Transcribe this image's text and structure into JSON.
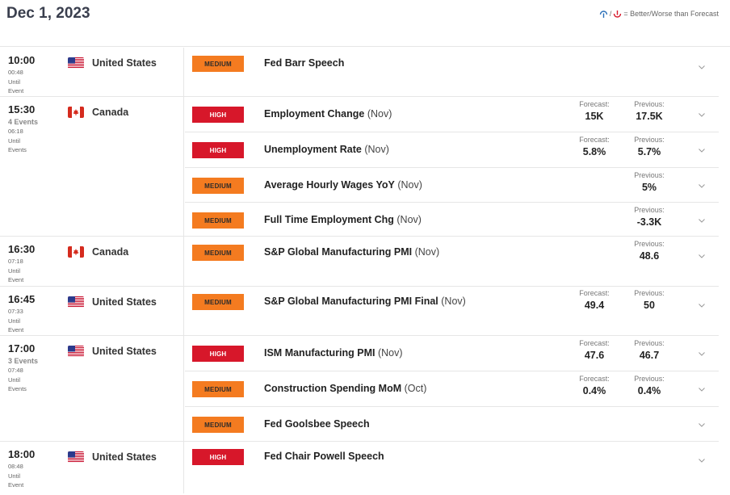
{
  "header": {
    "date": "Dec 1, 2023",
    "legend_slash": "/",
    "legend_text": "= Better/Worse than Forecast"
  },
  "colors": {
    "medium": "#f47b20",
    "high": "#d7172a"
  },
  "groups": [
    {
      "time": "10:00",
      "count": "",
      "until_time": "00:48",
      "until_label": "Until",
      "event_label": "Event",
      "country": "United States",
      "flag": "us-flag",
      "events": [
        {
          "impact": "MEDIUM",
          "level": "medium",
          "name": "Fed Barr Speech",
          "period": "",
          "forecast_label": "",
          "forecast": "",
          "previous_label": "",
          "previous": ""
        }
      ]
    },
    {
      "time": "15:30",
      "count": "4 Events",
      "until_time": "06:18",
      "until_label": "Until",
      "event_label": "Events",
      "country": "Canada",
      "flag": "ca-flag",
      "events": [
        {
          "impact": "HIGH",
          "level": "high",
          "name": "Employment Change",
          "period": "(Nov)",
          "forecast_label": "Forecast:",
          "forecast": "15K",
          "previous_label": "Previous:",
          "previous": "17.5K"
        },
        {
          "impact": "HIGH",
          "level": "high",
          "name": "Unemployment Rate",
          "period": "(Nov)",
          "forecast_label": "Forecast:",
          "forecast": "5.8%",
          "previous_label": "Previous:",
          "previous": "5.7%"
        },
        {
          "impact": "MEDIUM",
          "level": "medium",
          "name": "Average Hourly Wages YoY",
          "period": "(Nov)",
          "forecast_label": "",
          "forecast": "",
          "previous_label": "Previous:",
          "previous": "5%"
        },
        {
          "impact": "MEDIUM",
          "level": "medium",
          "name": "Full Time Employment Chg",
          "period": "(Nov)",
          "forecast_label": "",
          "forecast": "",
          "previous_label": "Previous:",
          "previous": "-3.3K"
        }
      ]
    },
    {
      "time": "16:30",
      "count": "",
      "until_time": "07:18",
      "until_label": "Until",
      "event_label": "Event",
      "country": "Canada",
      "flag": "ca-flag",
      "events": [
        {
          "impact": "MEDIUM",
          "level": "medium",
          "name": "S&P Global Manufacturing PMI",
          "period": "(Nov)",
          "forecast_label": "",
          "forecast": "",
          "previous_label": "Previous:",
          "previous": "48.6"
        }
      ]
    },
    {
      "time": "16:45",
      "count": "",
      "until_time": "07:33",
      "until_label": "Until",
      "event_label": "Event",
      "country": "United States",
      "flag": "us-flag",
      "events": [
        {
          "impact": "MEDIUM",
          "level": "medium",
          "name": "S&P Global Manufacturing PMI Final",
          "period": "(Nov)",
          "forecast_label": "Forecast:",
          "forecast": "49.4",
          "previous_label": "Previous:",
          "previous": "50"
        }
      ]
    },
    {
      "time": "17:00",
      "count": "3 Events",
      "until_time": "07:48",
      "until_label": "Until",
      "event_label": "Events",
      "country": "United States",
      "flag": "us-flag",
      "events": [
        {
          "impact": "HIGH",
          "level": "high",
          "name": "ISM Manufacturing PMI",
          "period": "(Nov)",
          "forecast_label": "Forecast:",
          "forecast": "47.6",
          "previous_label": "Previous:",
          "previous": "46.7"
        },
        {
          "impact": "MEDIUM",
          "level": "medium",
          "name": "Construction Spending MoM",
          "period": "(Oct)",
          "forecast_label": "Forecast:",
          "forecast": "0.4%",
          "previous_label": "Previous:",
          "previous": "0.4%"
        },
        {
          "impact": "MEDIUM",
          "level": "medium",
          "name": "Fed Goolsbee Speech",
          "period": "",
          "forecast_label": "",
          "forecast": "",
          "previous_label": "",
          "previous": ""
        }
      ]
    },
    {
      "time": "18:00",
      "count": "",
      "until_time": "08:48",
      "until_label": "Until",
      "event_label": "Event",
      "country": "United States",
      "flag": "us-flag",
      "events": [
        {
          "impact": "HIGH",
          "level": "high",
          "name": "Fed Chair Powell Speech",
          "period": "",
          "forecast_label": "",
          "forecast": "",
          "previous_label": "",
          "previous": ""
        }
      ]
    }
  ]
}
